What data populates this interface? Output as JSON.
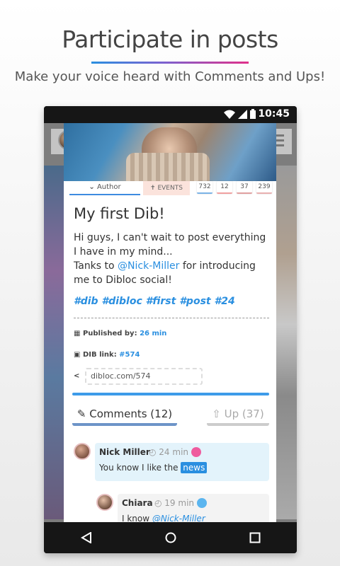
{
  "promo": {
    "title": "Participate in posts",
    "subtitle": "Make your voice heard with Comments and Ups!"
  },
  "status_bar": {
    "time": "10:45"
  },
  "post": {
    "tabs": {
      "author": "Author",
      "events": "EVENTS"
    },
    "stats": [
      "732",
      "12",
      "37",
      "239"
    ],
    "title": "My first Dib!",
    "body_1": "Hi guys, I can't wait to post everything I have in my mind...",
    "body_2": "Tanks to ",
    "mention": "@Nick-Miller",
    "body_3": " for introducing me to Dibloc social!",
    "tags": "#dib #dibloc #first #post #24",
    "published_label": "Published by:",
    "published_value": "26 min",
    "dib_link_label": "DIB link:",
    "dib_link_value": "#574",
    "share_url": "dibloc.com/574"
  },
  "actions": {
    "comments_label": "Comments (12)",
    "up_label": "Up (37)"
  },
  "comments": [
    {
      "name": "Nick Miller",
      "time": "24 min",
      "text": "You know I like the ",
      "highlight": "news"
    },
    {
      "name": "Chiara",
      "time": "19 min",
      "text": "I know ",
      "mention": "@Nick-Miller"
    }
  ],
  "colors": {
    "accent": "#2a8fe0",
    "brand_gradient": [
      "#2a8fe0",
      "#e0308a"
    ]
  }
}
